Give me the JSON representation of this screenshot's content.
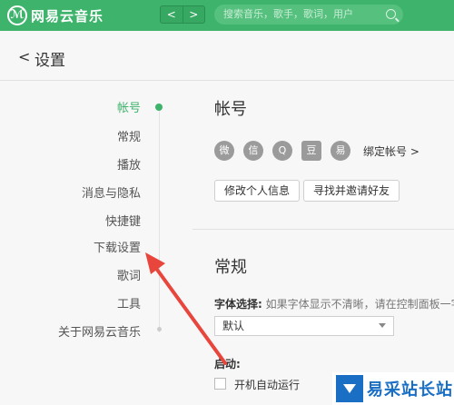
{
  "app": {
    "name": "网易云音乐",
    "logo_glyph": "ℳ"
  },
  "nav": {
    "back": "<",
    "forward": ">"
  },
  "search": {
    "placeholder": "搜索音乐，歌手，歌词，用户"
  },
  "header": {
    "back_glyph": "<",
    "title": "设置"
  },
  "sidebar": {
    "items": [
      {
        "label": "帐号",
        "active": true
      },
      {
        "label": "常规"
      },
      {
        "label": "播放"
      },
      {
        "label": "消息与隐私"
      },
      {
        "label": "快捷键"
      },
      {
        "label": "下载设置"
      },
      {
        "label": "歌词"
      },
      {
        "label": "工具"
      },
      {
        "label": "关于网易云音乐"
      }
    ]
  },
  "account": {
    "title": "帐号",
    "social": [
      "weibo-icon",
      "wechat-icon",
      "qq-icon",
      "douban-icon",
      "netease-icon"
    ],
    "bind_label": "绑定帐号 >",
    "edit_profile_btn": "修改个人信息",
    "find_friends_btn": "寻找并邀请好友"
  },
  "general": {
    "title": "常规",
    "font_label": "字体选择:",
    "font_hint": "如果字体显示不清晰，请在控制面板一字",
    "font_value": "默认",
    "autostart_label": "启动:",
    "autostart_option": "开机自动运行"
  },
  "watermark": {
    "text": "易采站长站"
  },
  "colors": {
    "accent": "#3db36b",
    "arrow": "#e8453c"
  }
}
